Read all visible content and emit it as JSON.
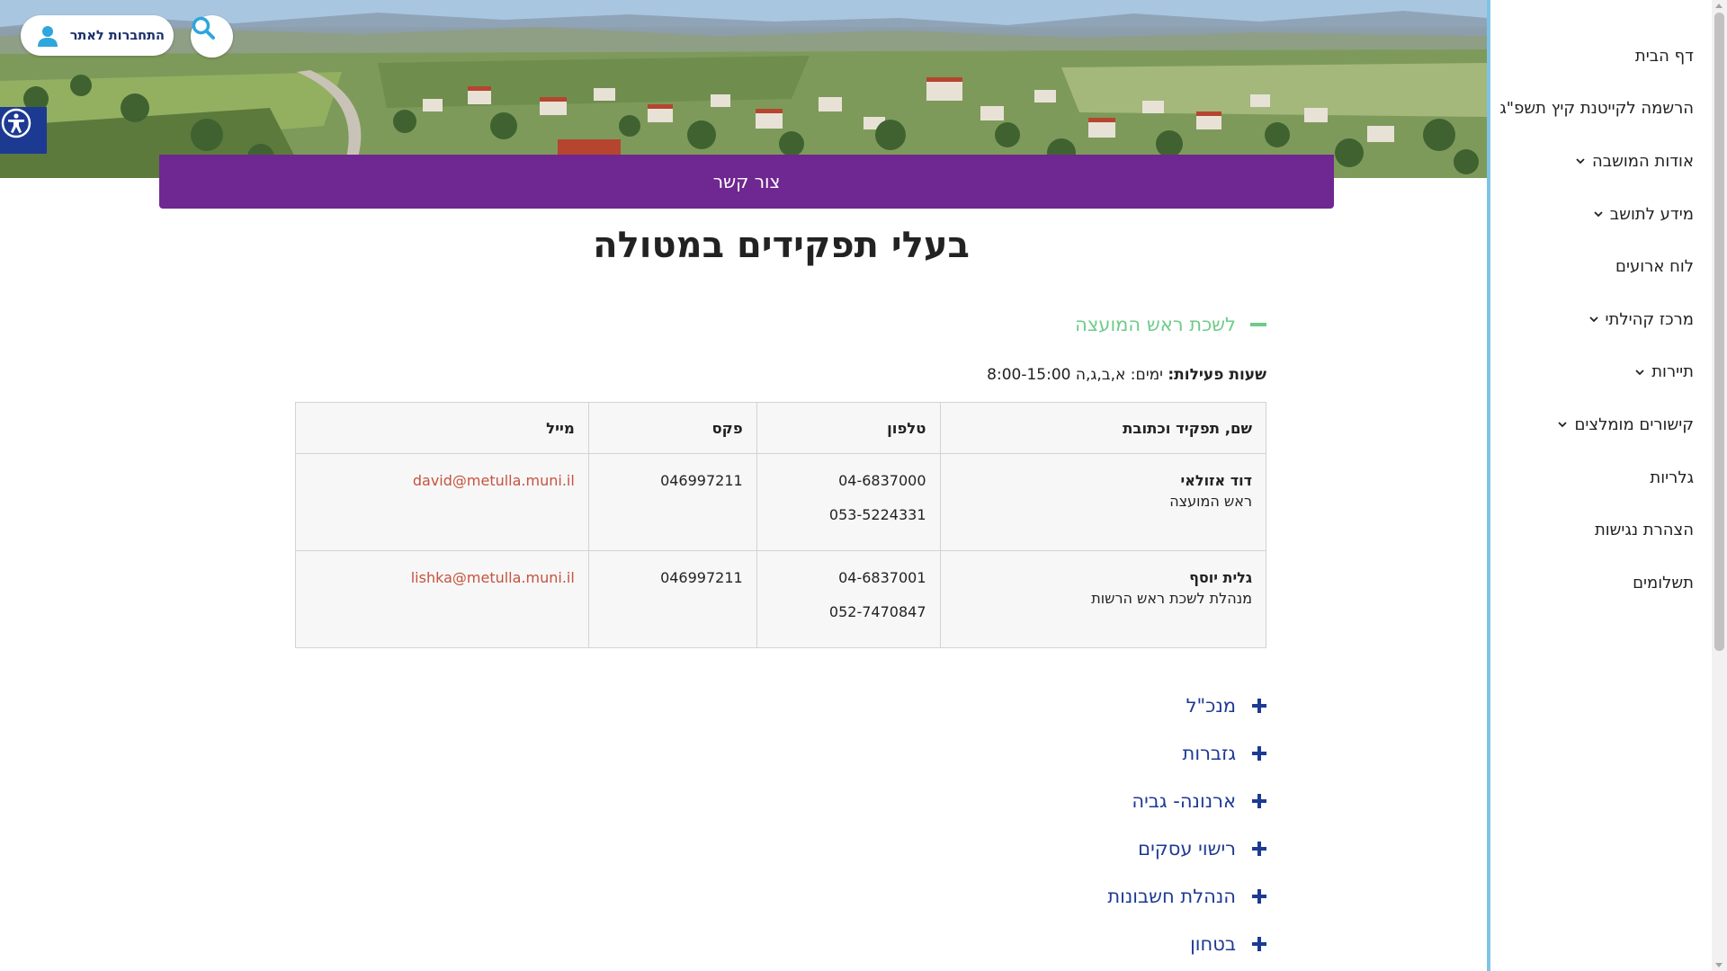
{
  "header": {
    "login_label": "התחברות לאתר",
    "contact_label": "צור קשר"
  },
  "page": {
    "title": "בעלי תפקידים במטולה"
  },
  "open_section": {
    "title": "לשכת ראש המועצה",
    "hours_label": "שעות פעילות:",
    "hours_text": "ימים: א,ב,ג,ה 8:00-15:00",
    "columns": [
      "שם, תפקיד וכתובת",
      "טלפון",
      "פקס",
      "מייל"
    ],
    "rows": [
      {
        "name": "דוד אזולאי",
        "role": "ראש המועצה",
        "phone1": "04-6837000",
        "phone2": "053-5224331",
        "fax": "046997211",
        "email": "david@metulla.muni.il"
      },
      {
        "name": "גלית יוסף",
        "role": "מנהלת לשכת ראש הרשות",
        "phone1": "04-6837001",
        "phone2": "052-7470847",
        "fax": "046997211",
        "email": "lishka@metulla.muni.il"
      }
    ]
  },
  "sections": [
    "מנכ\"ל",
    "גזברות",
    "ארנונה- גביה",
    "רישוי עסקים",
    "הנהלת חשבונות",
    "בטחון"
  ],
  "nav": {
    "items": [
      {
        "label": "דף הבית",
        "has_submenu": false
      },
      {
        "label": "הרשמה לקייטנת קיץ תשפ\"ג",
        "has_submenu": false
      },
      {
        "label": "אודות המושבה",
        "has_submenu": true
      },
      {
        "label": "מידע לתושב",
        "has_submenu": true
      },
      {
        "label": "לוח ארועים",
        "has_submenu": false
      },
      {
        "label": "מרכז קהילתי",
        "has_submenu": true
      },
      {
        "label": "תיירות",
        "has_submenu": true
      },
      {
        "label": "קישורים מומלצים",
        "has_submenu": true
      },
      {
        "label": "גלריות",
        "has_submenu": false
      },
      {
        "label": "הצהרת נגישות",
        "has_submenu": false
      },
      {
        "label": "תשלומים",
        "has_submenu": false
      }
    ]
  },
  "colors": {
    "purple": "#6f2791",
    "navy": "#1d3a93",
    "green_accent": "#6fcb89",
    "email_link": "#c6533e",
    "sidebar_border": "#7fc3e5"
  }
}
